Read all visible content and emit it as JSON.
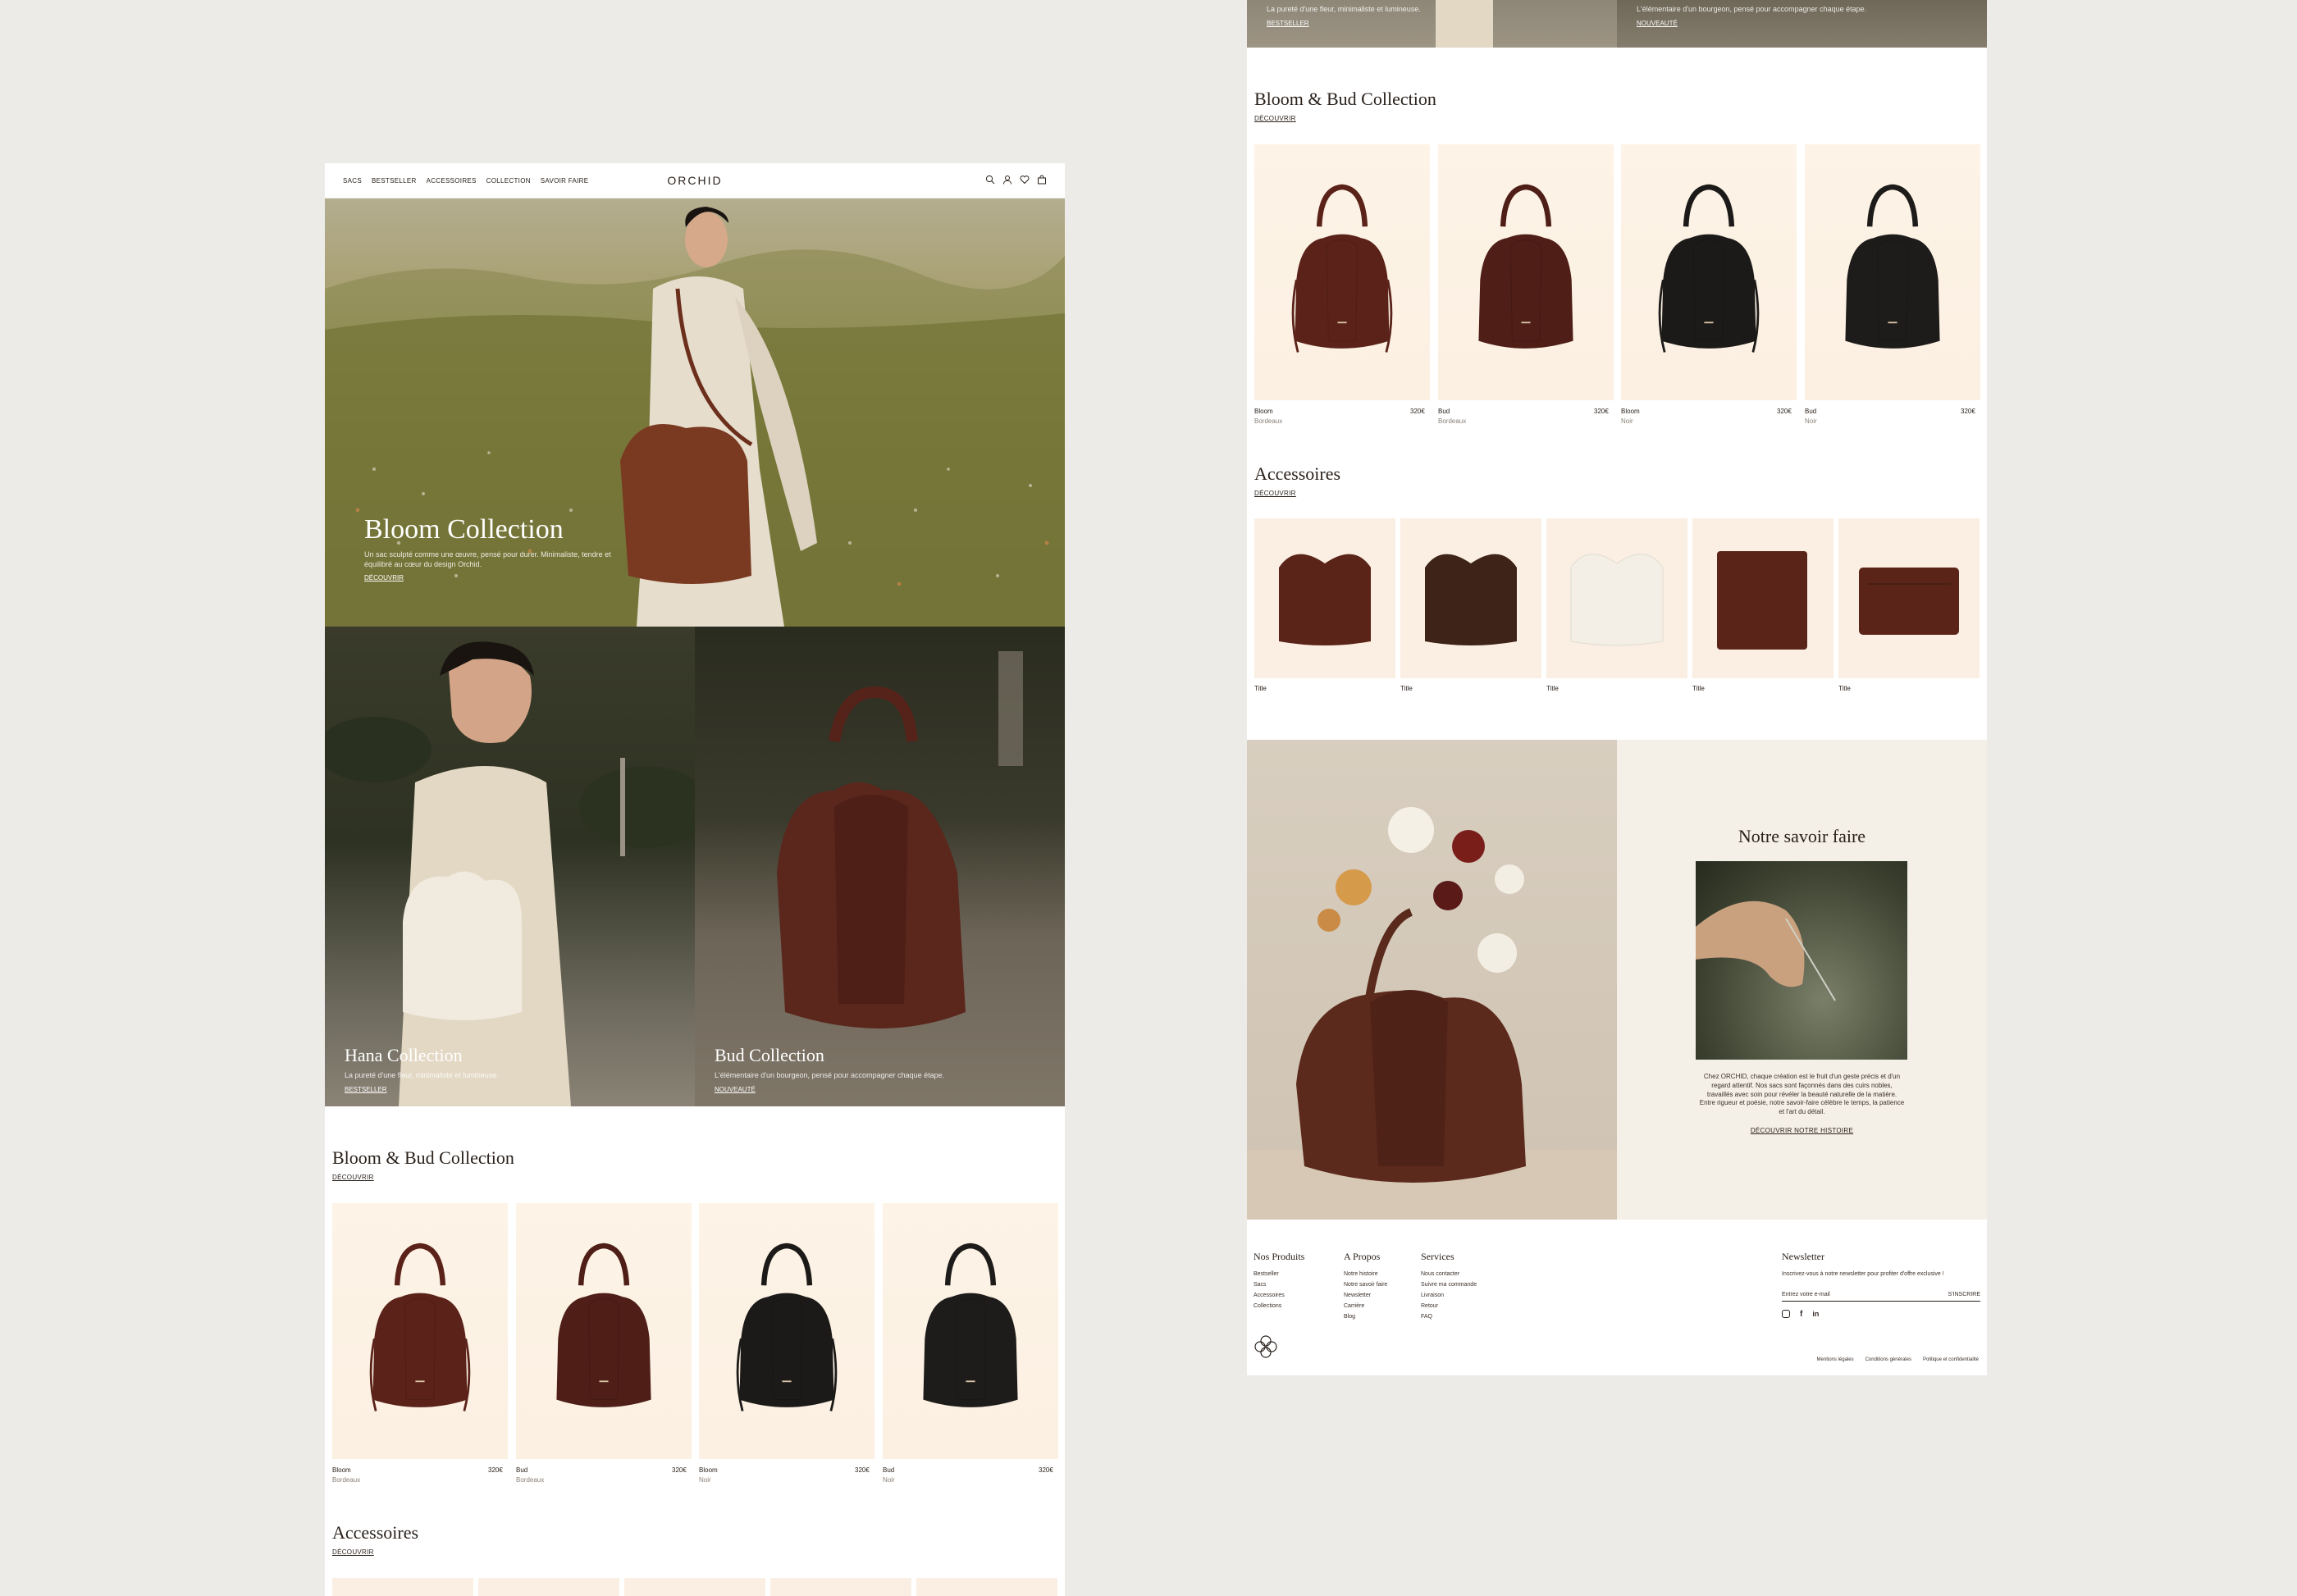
{
  "brand": {
    "logo": "ORCHID"
  },
  "nav": {
    "links": [
      "SACS",
      "BESTSELLER",
      "ACCESSOIRES",
      "COLLECTION",
      "SAVOIR FAIRE"
    ]
  },
  "hero": {
    "title": "Bloom Collection",
    "text": "Un sac sculpté comme une œuvre, pensé pour durer. Minimaliste, tendre et équilibré au cœur du design Orchid.",
    "link": "DÉCOUVRIR"
  },
  "hana": {
    "title": "Hana Collection",
    "text": "La pureté d'une fleur, minimaliste et lumineuse.",
    "link": "BESTSELLER"
  },
  "bud": {
    "title": "Bud Collection",
    "text": "L'élémentaire d'un bourgeon, pensé pour accompagner chaque étape.",
    "link": "NOUVEAUTÉ"
  },
  "bloombud": {
    "title": "Bloom & Bud Collection",
    "link": "DÉCOUVRIR",
    "products": [
      {
        "name": "Bloom",
        "color": "Bordeaux",
        "price": "320€",
        "tone": "#5a2218"
      },
      {
        "name": "Bud",
        "color": "Bordeaux",
        "price": "320€",
        "tone": "#4e1e17"
      },
      {
        "name": "Bloom",
        "color": "Noir",
        "price": "320€",
        "tone": "#1c1a18"
      },
      {
        "name": "Bud",
        "color": "Noir",
        "price": "320€",
        "tone": "#1e1c1a"
      }
    ]
  },
  "accessoires": {
    "title": "Accessoires",
    "link": "DÉCOUVRIR",
    "items": [
      {
        "title": "Title",
        "tone": "#5a2418"
      },
      {
        "title": "Title",
        "tone": "#3e2418"
      },
      {
        "title": "Title",
        "tone": "#f3efe6"
      },
      {
        "title": "Title",
        "tone": "#5a2418"
      },
      {
        "title": "Title",
        "tone": "#5a2418"
      }
    ]
  },
  "savoir": {
    "title": "Notre savoir faire",
    "text": "Chez ORCHID, chaque création est le fruit d'un geste précis et d'un regard attentif. Nos sacs sont façonnés dans des cuirs nobles, travaillés avec soin pour révéler la beauté naturelle de la matière. Entre rigueur et poésie, notre savoir-faire célèbre le temps, la patience et l'art du détail.",
    "link": "DÉCOUVRIR NOTRE HISTOIRE"
  },
  "footer": {
    "cols": [
      {
        "title": "Nos Produits",
        "items": [
          "Bestseller",
          "Sacs",
          "Accessoires",
          "Collections"
        ]
      },
      {
        "title": "A Propos",
        "items": [
          "Notre histoire",
          "Notre savoir faire",
          "Newsletter",
          "Carrière",
          "Blog"
        ]
      },
      {
        "title": "Services",
        "items": [
          "Nous contacter",
          "Suivre ma commande",
          "Livraison",
          "Retour",
          "FAQ"
        ]
      }
    ],
    "newsletter": {
      "title": "Newsletter",
      "text": "Inscrivez-vous à notre newsletter pour profiter d'offre exclusive !",
      "placeholder": "Entrez votre e-mail",
      "button": "S'INSCRIRE"
    },
    "legal": [
      "Mentions légales",
      "Conditions générales",
      "Politique et confidentialité"
    ]
  },
  "colors": {
    "bordeaux": "#5a2218",
    "cream": "#f4efe7",
    "ink": "#2a211b"
  }
}
